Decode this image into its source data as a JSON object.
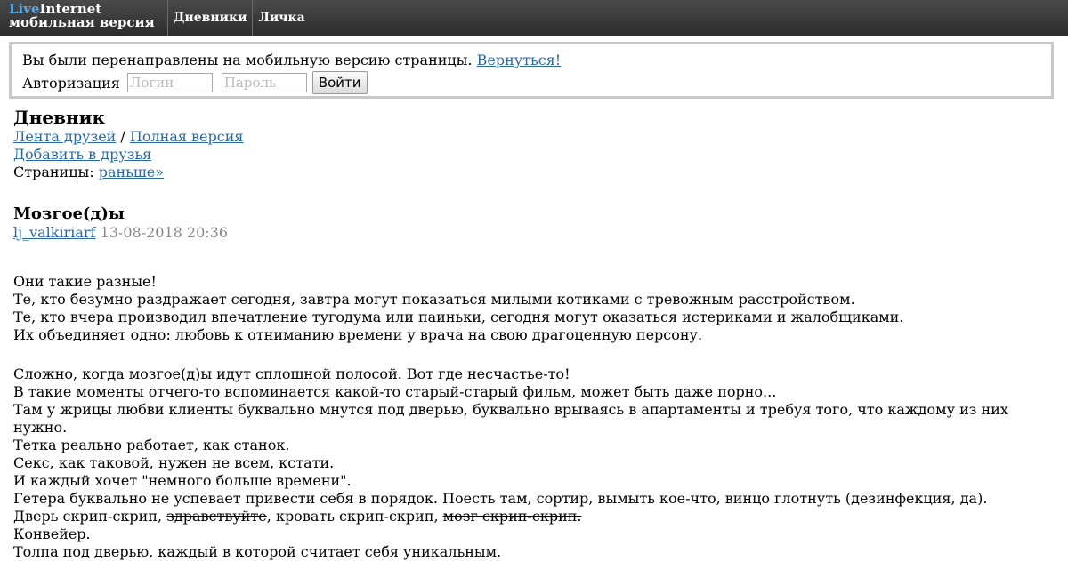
{
  "header": {
    "logo_live": "Live",
    "logo_internet": "Internet",
    "logo_sub": "мобильная версия",
    "nav": [
      {
        "label": "Дневники"
      },
      {
        "label": "Личка"
      }
    ]
  },
  "notice": {
    "text": "Вы были перенаправлены на мобильную версию страницы.",
    "return_link": "Вернуться!",
    "auth_label": "Авторизация",
    "login_placeholder": "Логин",
    "password_placeholder": "Пароль",
    "submit_label": "Войти"
  },
  "diary": {
    "heading": "Дневник",
    "friends_feed_link": "Лента друзей",
    "separator": "/",
    "full_version_link": "Полная версия",
    "add_friend_link": "Добавить в друзья",
    "pages_label": "Страницы:",
    "earlier_link": "раньше»"
  },
  "post": {
    "title": "Мозгое(д)ы",
    "author": "lj_valkiriarf",
    "date": "13-08-2018 20:36",
    "paragraph1": [
      "Они такие разные!",
      "Те, кто безумно раздражает сегодня, завтра могут показаться милыми котиками с тревожным расстройством.",
      "Те, кто вчера производил впечатление тугодума или паиньки, сегодня могут оказаться истериками и жалобщиками.",
      "Их объединяет одно: любовь к отниманию времени у врача на свою драгоценную персону."
    ],
    "paragraph2": [
      "Сложно, когда мозгое(д)ы идут сплошной полосой. Вот где несчастье-то!",
      "В такие моменты отчего-то вспоминается какой-то старый-старый фильм, может быть даже порно...",
      "Там у жрицы любви клиенты буквально мнутся под дверью, буквально врываясь в апартаменты и требуя того, что каждому из них нужно.",
      "Тетка реально работает, как станок.",
      "Секс, как таковой, нужен не всем, кстати.",
      "И каждый хочет \"немного больше времени\".",
      "Гетера буквально не успевает привести себя в порядок. Поесть там, сортир, вымыть кое-что, винцо глотнуть (дезинфекция, да)."
    ],
    "door_line": {
      "part1": "Дверь скрип-скрип, ",
      "strike1": "здравствуйте",
      "part2": ", кровать скрип-скрип, ",
      "strike2": "мозг скрип-скрип."
    },
    "paragraph3": [
      "Конвейер.",
      "Толпа под дверью, каждый в которой считает себя уникальным."
    ]
  }
}
